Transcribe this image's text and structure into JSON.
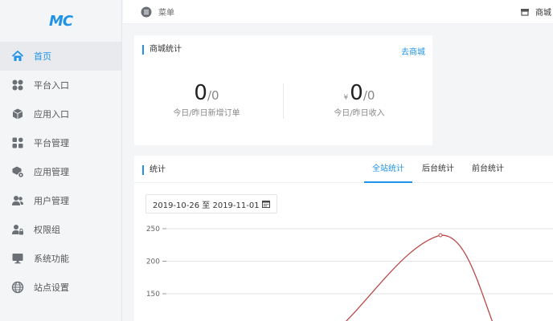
{
  "logo": {
    "text": "MC"
  },
  "sidebar": {
    "items": [
      {
        "label": "首页",
        "icon": "home-icon",
        "active": true
      },
      {
        "label": "平台入口",
        "icon": "grid-icon",
        "active": false
      },
      {
        "label": "应用入口",
        "icon": "cube-icon",
        "active": false
      },
      {
        "label": "平台管理",
        "icon": "apps-icon",
        "active": false
      },
      {
        "label": "应用管理",
        "icon": "cube-gear-icon",
        "active": false
      },
      {
        "label": "用户管理",
        "icon": "users-icon",
        "active": false
      },
      {
        "label": "权限组",
        "icon": "user-lock-icon",
        "active": false
      },
      {
        "label": "系统功能",
        "icon": "monitor-icon",
        "active": false
      },
      {
        "label": "站点设置",
        "icon": "globe-icon",
        "active": false
      }
    ]
  },
  "topbar": {
    "menu_label": "菜单",
    "shop_label": "商城"
  },
  "stats_card": {
    "title": "商城统计",
    "link": "去商城",
    "orders": {
      "main": "0",
      "sub": "/0",
      "label": "今日/昨日新增订单"
    },
    "income": {
      "currency": "¥",
      "main": "0",
      "sub": "/0",
      "label": "今日/昨日收入"
    }
  },
  "chart_card": {
    "title": "统计",
    "tabs": [
      {
        "label": "全站统计",
        "active": true
      },
      {
        "label": "后台统计",
        "active": false
      },
      {
        "label": "前台统计",
        "active": false
      }
    ],
    "date_range": "2019-10-26 至 2019-11-01"
  },
  "colors": {
    "accent": "#1f93e9",
    "line": "#b94a4a"
  },
  "chart_data": {
    "type": "line",
    "y_ticks": [
      250,
      200,
      150
    ],
    "ylim": [
      0,
      250
    ],
    "series": [
      {
        "points": [
          {
            "y_from_top": 0,
            "note": "start"
          }
        ]
      }
    ],
    "visible_points": [
      {
        "x_index": 3,
        "y": 240
      }
    ],
    "grid": true
  }
}
